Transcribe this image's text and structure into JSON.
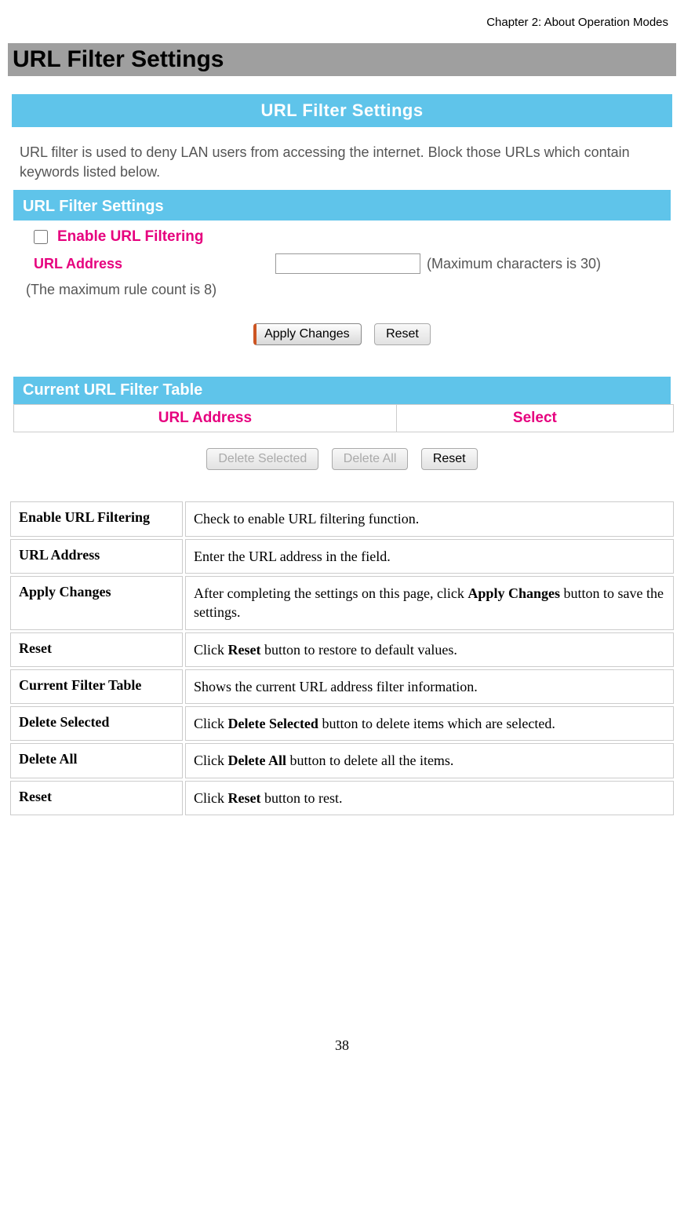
{
  "chapter": "Chapter 2: About Operation Modes",
  "page_title": "URL Filter Settings",
  "screenshot": {
    "main_header": "URL Filter Settings",
    "intro": "URL filter is used to deny LAN users from accessing the internet. Block those URLs which contain keywords listed below.",
    "settings_header": "URL Filter Settings",
    "enable_label": "Enable URL Filtering",
    "url_label": "URL Address",
    "url_hint": "(Maximum characters is 30)",
    "max_rule": "(The maximum rule count is 8)",
    "apply_btn": "Apply Changes",
    "reset_btn": "Reset",
    "table_header": "Current URL Filter Table",
    "col_url": "URL Address",
    "col_select": "Select",
    "delete_selected_btn": "Delete Selected",
    "delete_all_btn": "Delete All",
    "table_reset_btn": "Reset"
  },
  "definitions": [
    {
      "term": "Enable URL Filtering",
      "desc": "Check to enable URL filtering function."
    },
    {
      "term": "URL Address",
      "desc": "Enter the URL address in the field."
    },
    {
      "term": "Apply Changes",
      "desc": "After completing the settings on this page, click <b>Apply Changes</b> button to save the settings."
    },
    {
      "term": "Reset",
      "desc": "Click <b>Reset</b> button to restore to default values."
    },
    {
      "term": "Current Filter Table",
      "desc": "Shows the current URL address filter information."
    },
    {
      "term": "Delete Selected",
      "desc": "Click <b>Delete Selected</b> button to delete items which are selected."
    },
    {
      "term": "Delete All",
      "desc": "Click <b>Delete All</b> button to delete all the items."
    },
    {
      "term": "Reset",
      "desc": "Click <b>Reset</b> button to rest."
    }
  ],
  "page_number": "38"
}
